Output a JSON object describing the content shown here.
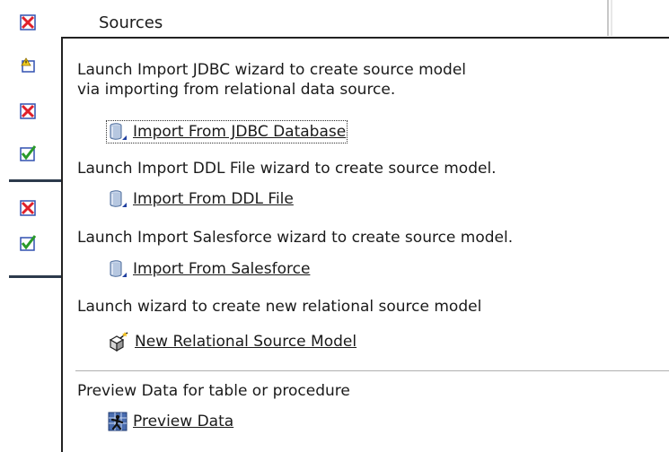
{
  "background": {
    "title": "Sources"
  },
  "popup": {
    "sections": [
      {
        "description_lines": [
          "Launch Import JDBC wizard to create source model",
          "via importing from relational data source."
        ],
        "action_label": "Import From JDBC Database",
        "icon": "database-icon"
      },
      {
        "description_lines": [
          "Launch Import DDL File wizard to create source model."
        ],
        "action_label": "Import From DDL File",
        "icon": "database-icon"
      },
      {
        "description_lines": [
          "Launch Import Salesforce wizard to create source model."
        ],
        "action_label": "Import From Salesforce",
        "icon": "database-icon"
      },
      {
        "description_lines": [
          "Launch wizard to create new relational source model"
        ],
        "action_label": "New Relational Source Model",
        "icon": "new-model-wizard-icon"
      },
      {
        "description_lines": [
          "Preview Data for table or procedure"
        ],
        "action_label": "Preview Data",
        "icon": "preview-data-icon"
      }
    ]
  },
  "colors": {
    "error_red": "#e0202a",
    "check_green": "#2a9a2a",
    "db_blue": "#6f8fc0"
  }
}
